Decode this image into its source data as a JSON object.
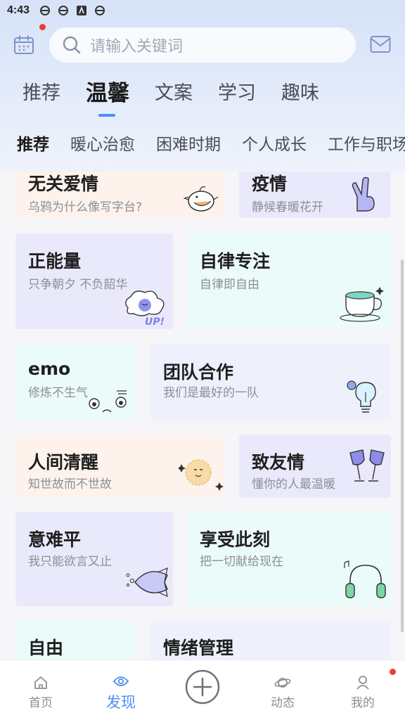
{
  "status_bar": {
    "time": "4:43",
    "icons": [
      "browser-icon",
      "browser-icon",
      "app-icon",
      "browser-icon"
    ]
  },
  "header": {
    "search_placeholder": "请输入关键词",
    "notification_dot_color": "#ef3a3a"
  },
  "main_tabs": [
    {
      "label": "推荐",
      "active": false
    },
    {
      "label": "温馨",
      "active": true
    },
    {
      "label": "文案",
      "active": false
    },
    {
      "label": "学习",
      "active": false
    },
    {
      "label": "趣味",
      "active": false
    }
  ],
  "sub_tabs": [
    {
      "label": "推荐",
      "active": true
    },
    {
      "label": "暖心治愈",
      "active": false
    },
    {
      "label": "困难时期",
      "active": false
    },
    {
      "label": "个人成长",
      "active": false
    },
    {
      "label": "工作与职场",
      "active": false
    }
  ],
  "cards": [
    {
      "title": "无关爱情",
      "subtitle": "乌鸦为什么像写字台?",
      "icon": "bird-icon"
    },
    {
      "title": "疫情",
      "subtitle": "静候春暖花开",
      "icon": "victory-hand-icon"
    },
    {
      "title": "正能量",
      "subtitle": "只争朝夕 不负韶华",
      "icon": "up-cloud-icon"
    },
    {
      "title": "自律专注",
      "subtitle": "自律即自由",
      "icon": "teacup-icon"
    },
    {
      "title": "emo",
      "subtitle": "修炼不生气",
      "icon": "sleepy-face-icon"
    },
    {
      "title": "团队合作",
      "subtitle": "我们是最好的一队",
      "icon": "lightbulb-icon"
    },
    {
      "title": "人间清醒",
      "subtitle": "知世故而不世故",
      "icon": "sun-face-icon"
    },
    {
      "title": "致友情",
      "subtitle": "懂你的人最温暖",
      "icon": "wine-glasses-icon"
    },
    {
      "title": "意难平",
      "subtitle": "我只能欲言又止",
      "icon": "fish-icon"
    },
    {
      "title": "享受此刻",
      "subtitle": "把一切献给现在",
      "icon": "headphones-icon"
    },
    {
      "title": "自由",
      "subtitle": "",
      "icon": ""
    },
    {
      "title": "情绪管理",
      "subtitle": "",
      "icon": ""
    }
  ],
  "bottom_nav": [
    {
      "label": "首页",
      "icon": "home-icon",
      "active": false
    },
    {
      "label": "发现",
      "icon": "eye-icon",
      "active": true
    },
    {
      "label": "动态",
      "icon": "planet-icon",
      "active": false
    },
    {
      "label": "我的",
      "icon": "user-icon",
      "active": false
    }
  ],
  "colors": {
    "accent": "#4d8ef4",
    "badge": "#ef3a3a",
    "card_peach": "#fdf3ec",
    "card_lavender": "#e9e9fb",
    "card_mint": "#ebfbf9",
    "card_blue": "#eef1fc"
  }
}
